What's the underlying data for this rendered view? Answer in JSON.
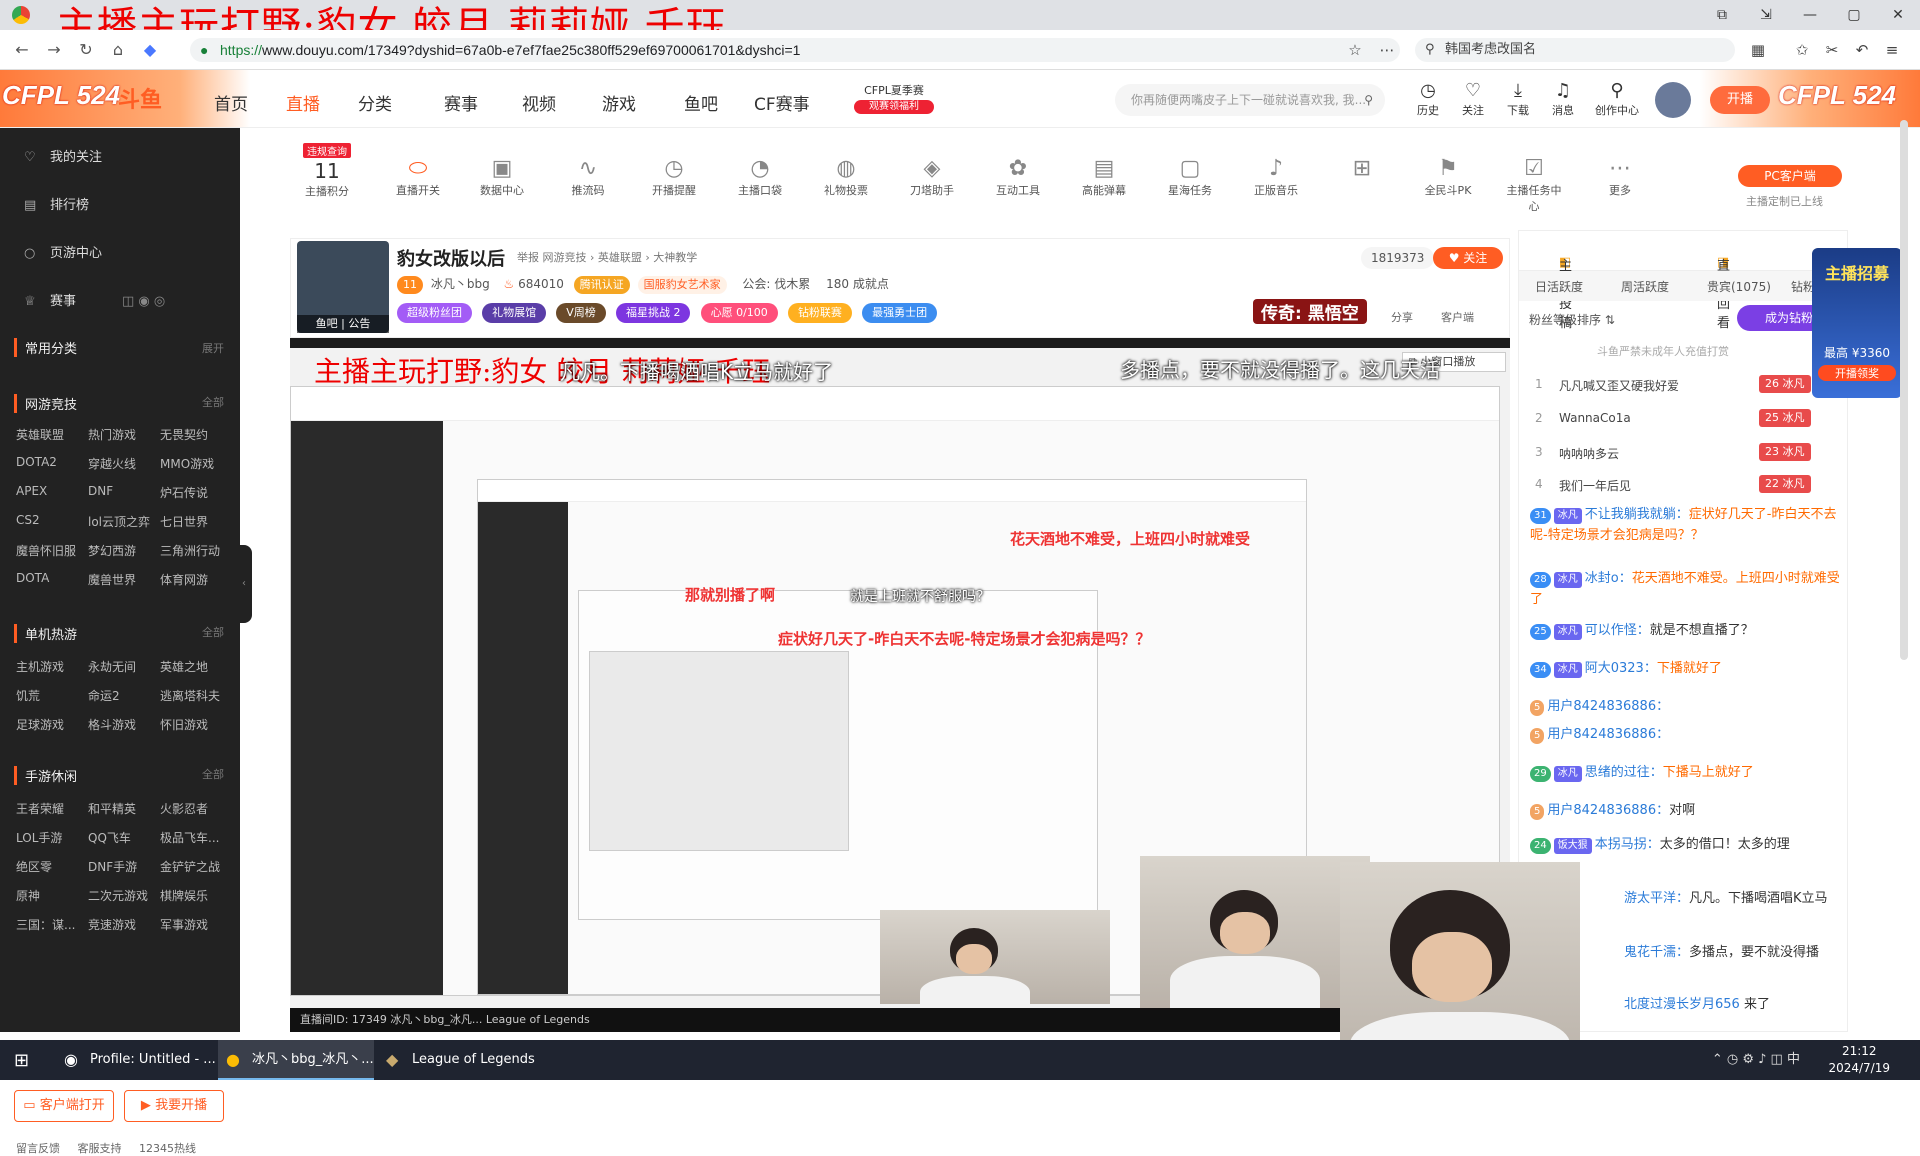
{
  "overlay": {
    "title": "主播主玩打野:豹女  皎月  莉莉娅  千珏"
  },
  "browser": {
    "url_scheme": "https://",
    "url_rest": "www.douyu.com/17349?dyshid=67a0b-e7ef7fae25c380ff529ef69700061701&dyshci=1",
    "search_text": "韩国考虑改国名"
  },
  "header": {
    "brand_left": "CFPL 524",
    "logo": "斗鱼",
    "nav": [
      "首页",
      "直播",
      "分类",
      "赛事",
      "视频",
      "游戏",
      "鱼吧",
      "CF赛事"
    ],
    "cfpl_badge": "CFPL夏季赛",
    "cfpl_sub": "观赛领福利",
    "search_placeholder": "你再随便两嘴皮子上下一碰就说喜欢我, 我...",
    "icons": [
      "历史",
      "关注",
      "下载",
      "消息",
      "创作中心"
    ],
    "start_label": "开播",
    "brand_right": "CFPL 524"
  },
  "sidebar": {
    "items": [
      "我的关注",
      "排行榜",
      "页游中心",
      "赛事"
    ],
    "common": "常用分类",
    "expand": "展开",
    "all": "全部",
    "sections": [
      {
        "title": "网游竞技",
        "games": [
          "英雄联盟",
          "热门游戏",
          "无畏契约",
          "DOTA2",
          "穿越火线",
          "MMO游戏",
          "APEX",
          "DNF",
          "炉石传说",
          "CS2",
          "lol云顶之弈",
          "七日世界",
          "魔兽怀旧服",
          "梦幻西游",
          "三角洲行动",
          "DOTA",
          "魔兽世界",
          "体育网游"
        ]
      },
      {
        "title": "单机热游",
        "games": [
          "主机游戏",
          "永劫无间",
          "英雄之地",
          "饥荒",
          "命运2",
          "逃离塔科夫",
          "足球游戏",
          "格斗游戏",
          "怀旧游戏"
        ]
      },
      {
        "title": "手游休闲",
        "games": [
          "王者荣耀",
          "和平精英",
          "火影忍者",
          "LOL手游",
          "QQ飞车",
          "极品飞车...",
          "绝区零",
          "DNF手游",
          "金铲铲之战",
          "原神",
          "二次元游戏",
          "棋牌娱乐",
          "三国：谋...",
          "竞速游戏",
          "军事游戏"
        ]
      }
    ],
    "btn_client": "客户端打开",
    "btn_start": "我要开播",
    "footer": "留言反馈 客服支持 12345热线"
  },
  "toolbar": {
    "violation": "违规查询",
    "score_value": "11",
    "score_label": "主播积分",
    "tools": [
      "直播开关",
      "数据中心",
      "推流码",
      "开播提醒",
      "主播口袋",
      "礼物投票",
      "刀塔助手",
      "互动工具",
      "高能弹幕",
      "星海任务",
      "正版音乐",
      "",
      "全民斗PK",
      "主播任务中心",
      "更多"
    ],
    "pc_client": "PC客户端",
    "pc_note": "主播定制已上线"
  },
  "room": {
    "title": "豹女改版以后",
    "meta": "举报  网游竞技 › 英雄联盟 › 大神教学",
    "level": "11",
    "streamer": "冰凡丶bbg",
    "hot": "684010",
    "certified": "腾讯认证",
    "art": "国服豹女艺术家",
    "guild": "公会: 伐木累",
    "achieve": "180 成就点",
    "badges": [
      "超级粉丝团",
      "礼物展馆",
      "V周榜",
      "福星挑战 2",
      "心愿 0/100",
      "钻粉联赛",
      "最强勇士团"
    ],
    "follow_count": "1819373",
    "follow_label": "关注",
    "legend_tag": "传奇: 黑悟空",
    "avatar_caption": "鱼吧 | 公告",
    "share": "分享",
    "client": "客户端"
  },
  "video": {
    "danmaku": [
      "凡凡。下播喝酒唱K立马就好了",
      "多播点，要不就没得播了。这几天活",
      "花天酒地不难受，上班四小时就难受",
      "症状好几天了-昨白天不去呢-特定场景才会犯病是吗？？",
      "那就别播了啊",
      "就是上班就不舒服吗？"
    ],
    "mini_window": "小窗口播放",
    "bottom_bar": "直播间ID: 17349   冰凡丶bbg_冰凡...   League of Legends"
  },
  "right_panel": {
    "tab_submit": "主播投稿",
    "tab_replay": "直播回看",
    "rank_tabs": [
      "日活跃度",
      "周活跃度",
      "贵宾(1075)",
      "钻粉"
    ],
    "fan_sort": "粉丝等级排序",
    "fan_btn": "成为钻粉",
    "fan_note": "斗鱼严禁未成年人充值打赏",
    "ranks": [
      {
        "n": "1",
        "name": "凡凡喊又歪又硬我好爱",
        "lv": "26 冰凡"
      },
      {
        "n": "2",
        "name": "WannaCo1a",
        "lv": "25 冰凡"
      },
      {
        "n": "3",
        "name": "呐呐呐多云",
        "lv": "23 冰凡"
      },
      {
        "n": "4",
        "name": "我们一年后见",
        "lv": "22 冰凡"
      }
    ],
    "promo_title": "主播招募",
    "promo_mid": "最高 ¥3360",
    "promo_btn": "开播领奖"
  },
  "chat": [
    {
      "lv": "31",
      "fan": "冰凡",
      "user": "不让我躺我就躺：",
      "text": "症状好几天了-昨白天不去呢-特定场景才会犯病是吗？？"
    },
    {
      "lv": "28",
      "fan": "冰凡",
      "user": "冰封o：",
      "text": "花天酒地不难受。上班四小时就难受了"
    },
    {
      "lv": "25",
      "fan": "冰凡",
      "user": "可以作怪：",
      "text": "就是不想直播了？"
    },
    {
      "lv": "34",
      "fan": "冰凡",
      "user": "阿大0323：",
      "text": "下播就好了"
    },
    {
      "lv": "5",
      "fan": "",
      "user": "用户8424836886：",
      "text": ""
    },
    {
      "lv": "5",
      "fan": "",
      "user": "用户8424836886：",
      "text": ""
    },
    {
      "lv": "29",
      "fan": "冰凡",
      "user": "思绪的过往：",
      "text": "下播马上就好了"
    },
    {
      "lv": "5",
      "fan": "",
      "user": "用户8424836886：",
      "text": "对啊"
    },
    {
      "lv": "24",
      "fan": "饭大狠",
      "user": "本拐马拐：",
      "text": "太多的借口！太多的理"
    },
    {
      "lv": "",
      "fan": "",
      "user": "游太平洋：",
      "text": "凡凡。下播喝酒唱K立马"
    },
    {
      "lv": "",
      "fan": "",
      "user": "鬼花千濡：",
      "text": "多播点，要不就没得播"
    },
    {
      "lv": "",
      "fan": "",
      "user": "北度过漫长岁月656",
      "text": "来了"
    }
  ],
  "taskbar": {
    "tasks": [
      "Profile: Untitled - ...",
      "冰凡丶bbg_冰凡丶...",
      "League of Legends"
    ],
    "time": "21:12",
    "date": "2024/7/19",
    "tray": "中"
  }
}
